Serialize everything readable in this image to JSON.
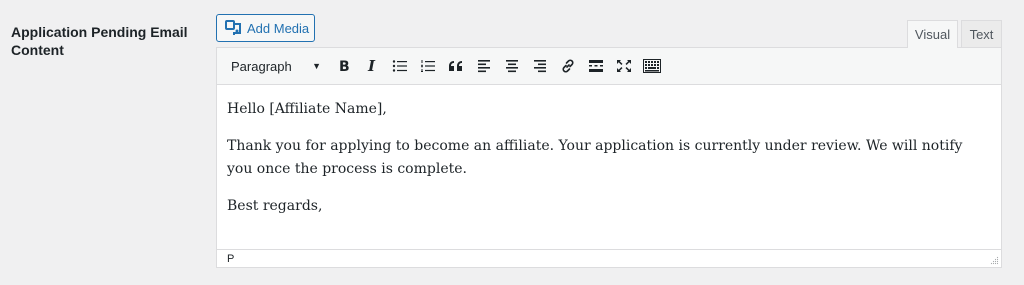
{
  "field": {
    "label": "Application Pending Email Content"
  },
  "media": {
    "add_media_label": "Add Media",
    "icon": "media-icon"
  },
  "tabs": {
    "visual": "Visual",
    "text": "Text",
    "active": "Visual"
  },
  "toolbar": {
    "format_value": "Paragraph",
    "buttons": [
      "bold-icon",
      "italic-icon",
      "bulleted-list-icon",
      "numbered-list-icon",
      "blockquote-icon",
      "align-left-icon",
      "align-center-icon",
      "align-right-icon",
      "link-icon",
      "read-more-icon",
      "fullscreen-icon",
      "toolbar-toggle-icon"
    ]
  },
  "content": {
    "paragraphs": [
      "Hello [Affiliate Name],",
      "Thank you for applying to become an affiliate. Your application is currently under review. We will notify you once the process is complete.",
      "Best regards,"
    ]
  },
  "statusbar": {
    "path": "P"
  },
  "colors": {
    "accent": "#2271b1",
    "background": "#f0f0f1",
    "border": "#dcdcde",
    "toolbar_bg": "#f6f7f7",
    "text": "#1d2327"
  }
}
